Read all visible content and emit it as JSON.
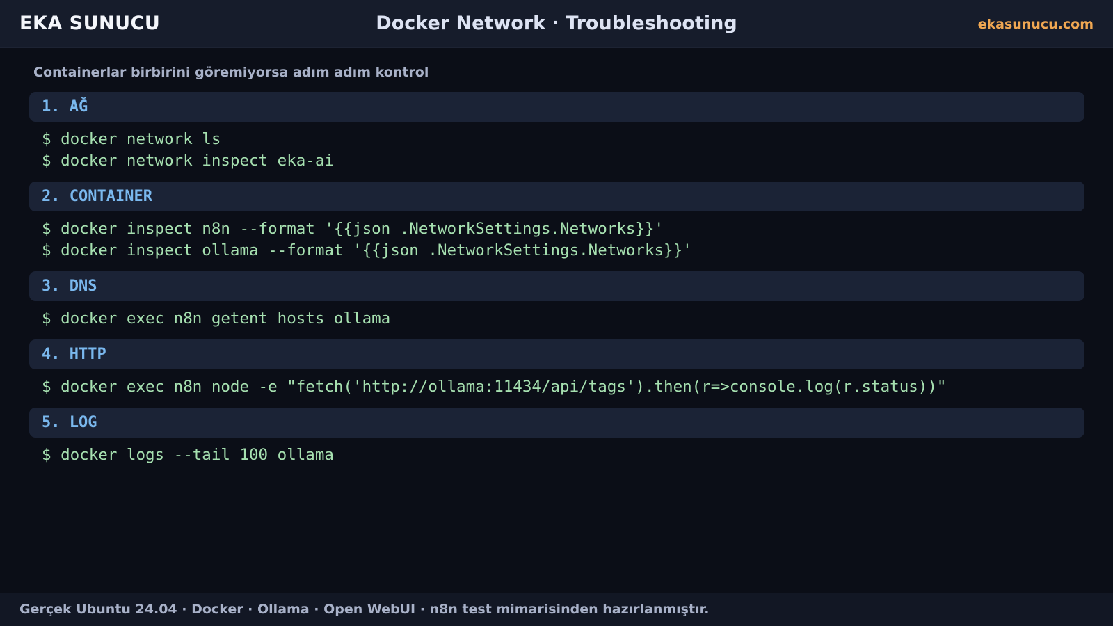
{
  "header": {
    "brand": "EKA SUNUCU",
    "title": "Docker Network · Troubleshooting",
    "site": "ekasunucu.com"
  },
  "subtitle": "Containerlar birbirini göremiyorsa adım adım kontrol",
  "sections": [
    {
      "title": "1. AĞ",
      "commands": [
        "$ docker network ls",
        "$ docker network inspect eka-ai"
      ]
    },
    {
      "title": "2. CONTAINER",
      "commands": [
        "$ docker inspect n8n --format '{{json .NetworkSettings.Networks}}'",
        "$ docker inspect ollama --format '{{json .NetworkSettings.Networks}}'"
      ]
    },
    {
      "title": "3. DNS",
      "commands": [
        "$ docker exec n8n getent hosts ollama"
      ]
    },
    {
      "title": "4. HTTP",
      "commands": [
        "$ docker exec n8n node -e \"fetch('http://ollama:11434/api/tags').then(r=>console.log(r.status))\""
      ]
    },
    {
      "title": "5. LOG",
      "commands": [
        "$ docker logs --tail 100 ollama"
      ]
    }
  ],
  "footer": {
    "text": "Gerçek Ubuntu 24.04 · Docker · Ollama · Open WebUI · n8n test mimarisinden hazırlanmıştır."
  },
  "colors": {
    "background": "#0b0e17",
    "bar": "#161c2b",
    "section_header_bg": "#1b2336",
    "section_title": "#7ab8ee",
    "command_text": "#a6e0b0",
    "site_link": "#f0a752",
    "muted_text": "#a8b1c8"
  }
}
